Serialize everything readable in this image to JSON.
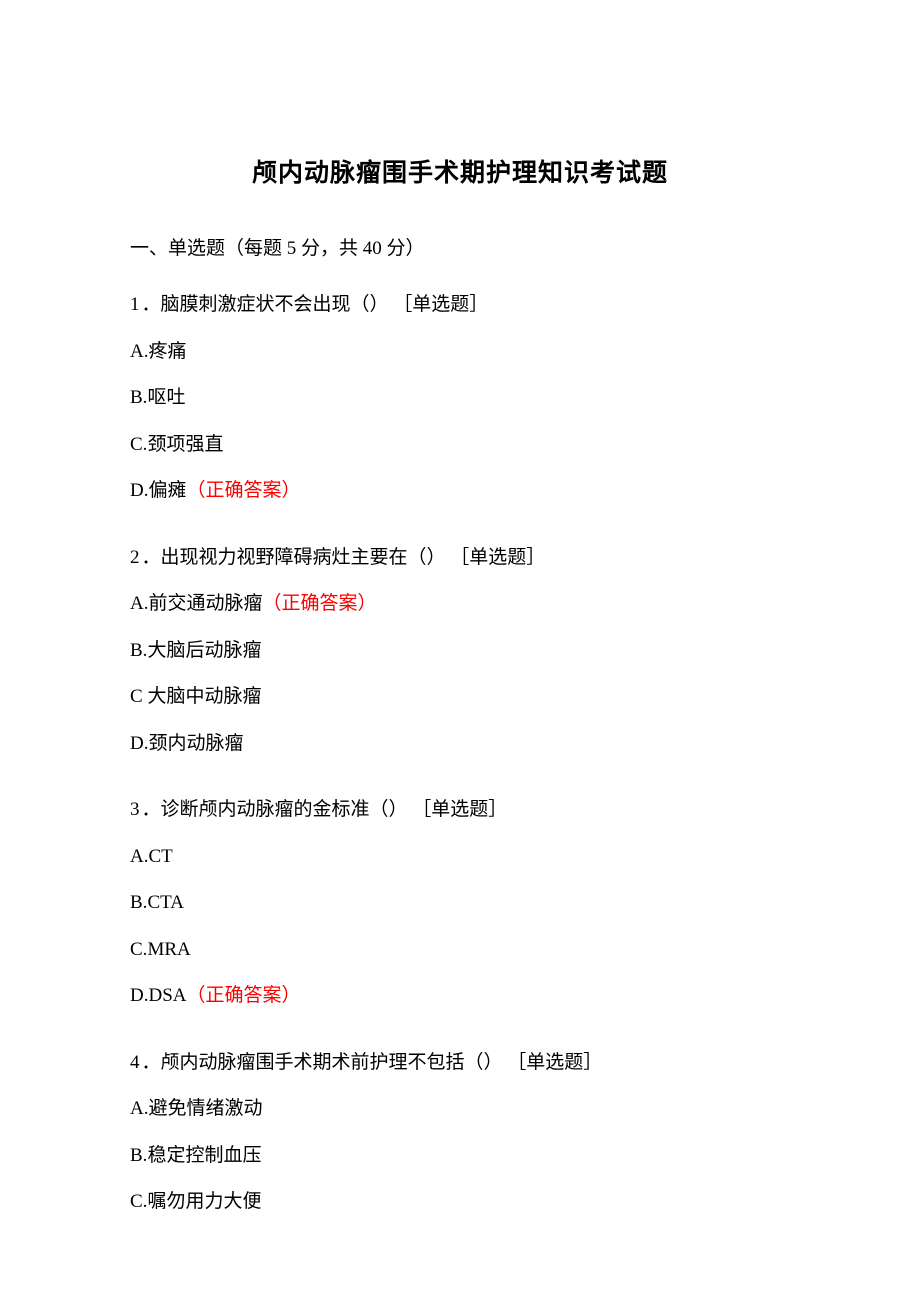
{
  "title": "颅内动脉瘤围手术期护理知识考试题",
  "section_header": "一、单选题（每题 5 分，共 40 分）",
  "answer_label_text": "（正确答案）",
  "questions": [
    {
      "num": "1",
      "text": "．脑膜刺激症状不会出现（） ［单选题］",
      "options": [
        {
          "letter": "A.",
          "text": "疼痛",
          "correct": false
        },
        {
          "letter": "B.",
          "text": "呕吐",
          "correct": false
        },
        {
          "letter": "C.",
          "text": "颈项强直",
          "correct": false
        },
        {
          "letter": "D.",
          "text": "偏瘫",
          "correct": true
        }
      ]
    },
    {
      "num": "2",
      "text": "．出现视力视野障碍病灶主要在（） ［单选题］",
      "options": [
        {
          "letter": "A.",
          "text": "前交通动脉瘤",
          "correct": true
        },
        {
          "letter": "B.",
          "text": "大脑后动脉瘤",
          "correct": false
        },
        {
          "letter": "C",
          "text": " 大脑中动脉瘤",
          "correct": false
        },
        {
          "letter": "D.",
          "text": "颈内动脉瘤",
          "correct": false
        }
      ]
    },
    {
      "num": "3",
      "text": "．诊断颅内动脉瘤的金标准（） ［单选题］",
      "options": [
        {
          "letter": "A.",
          "text": "CT",
          "correct": false
        },
        {
          "letter": "B.",
          "text": "CTA",
          "correct": false
        },
        {
          "letter": "C.",
          "text": "MRA",
          "correct": false
        },
        {
          "letter": "D.",
          "text": "DSA",
          "correct": true
        }
      ]
    },
    {
      "num": "4",
      "text": "．颅内动脉瘤围手术期术前护理不包括（） ［单选题］",
      "options": [
        {
          "letter": "A.",
          "text": "避免情绪激动",
          "correct": false
        },
        {
          "letter": "B.",
          "text": "稳定控制血压",
          "correct": false
        },
        {
          "letter": "C.",
          "text": "嘱勿用力大便",
          "correct": false
        }
      ]
    }
  ]
}
